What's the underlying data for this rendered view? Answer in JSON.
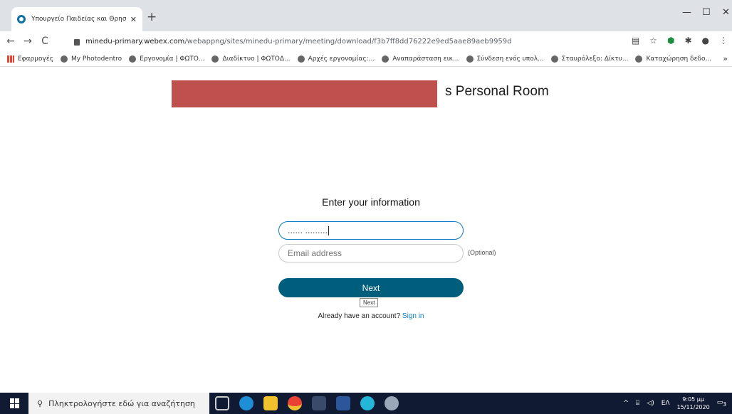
{
  "browser": {
    "tab_title": "Υπουργείο Παιδείας και Θρησκε",
    "tab_close": "✕",
    "new_tab": "+",
    "url_host": "minedu-primary.webex.com",
    "url_path": "/webappng/sites/minedu-primary/meeting/download/f3b7ff8dd76222e9ed5aae89aeb9959d",
    "bookmarks": [
      "Εφαρμογές",
      "My Photodentro",
      "Εργονομία | ΦΩΤΟ...",
      "Διαδίκτυο | ΦΩΤΟΔ...",
      "Αρχές εργονομίας:...",
      "Αναπαράσταση εικ...",
      "Σύνδεση ενός υπολ...",
      "Σταυρόλεξο: Δίκτυ...",
      "Καταχώρηση δεδο..."
    ],
    "bookmarks_more": "»"
  },
  "page": {
    "room_title": "s Personal Room",
    "heading": "Enter your information",
    "name_value": "......  .........",
    "email_placeholder": "Email address",
    "optional_label": "(Optional)",
    "next_label": "Next",
    "tooltip": "Next",
    "account_prompt": "Already have an account?",
    "signin_label": "Sign in"
  },
  "taskbar": {
    "search_placeholder": "Πληκτρολογήστε εδώ για αναζήτηση",
    "language": "ΕΛ",
    "time": "9:05 μμ",
    "date": "15/11/2020",
    "notification_count": "3"
  },
  "colors": {
    "accent": "#005e7d",
    "link": "#0b7cbf",
    "redaction": "#c0504d",
    "taskbar": "#101b33"
  }
}
